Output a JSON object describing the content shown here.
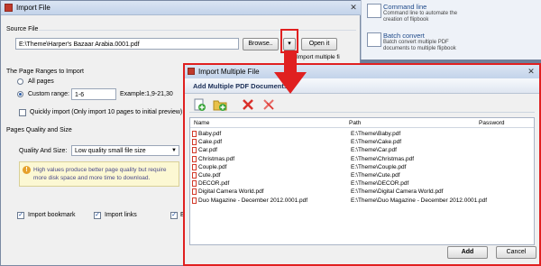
{
  "import_file": {
    "title": "Import File",
    "source_section": "Source File",
    "source_path": "E:\\Theme\\Harper's Bazaar Arabia.0001.pdf",
    "browse_label": "Browse..",
    "open_label": "Open it",
    "import_multiple_label": "Import multiple fi",
    "page_ranges_section": "The Page Ranges to Import",
    "all_pages_label": "All pages",
    "custom_range_label": "Custom range:",
    "custom_range_value": "1-6",
    "range_example": "Example:1,9-21,30",
    "quick_import_label": "Quickly import (Only import 10 pages to  initial  preview)",
    "quality_section": "Pages Quality and Size",
    "quality_label": "Quality And Size:",
    "quality_value": "Low quality small file size",
    "hint_text": "High values produce better page quality but require more disk space and more time to download.",
    "import_bookmark_label": "Import bookmark",
    "import_links_label": "Import links",
    "truncated_label": "Ena"
  },
  "side_panel": {
    "items": [
      {
        "title": "Command line",
        "desc": "Command line to automate the creation of flipbook"
      },
      {
        "title": "Batch convert",
        "desc": "Batch convert multiple PDF documents to multiple flipbook"
      }
    ]
  },
  "multi_window": {
    "title": "Import Multiple File",
    "header": "Add Multiple PDF Documents",
    "toolbar": [
      "add-file-icon",
      "add-folder-icon",
      "remove-icon",
      "remove-all-icon"
    ],
    "columns": [
      "Name",
      "Path",
      "Password"
    ],
    "rows": [
      {
        "name": "Baby.pdf",
        "path": "E:\\Theme\\Baby.pdf"
      },
      {
        "name": "Cake.pdf",
        "path": "E:\\Theme\\Cake.pdf"
      },
      {
        "name": "Car.pdf",
        "path": "E:\\Theme\\Car.pdf"
      },
      {
        "name": "Christmas.pdf",
        "path": "E:\\Theme\\Christmas.pdf"
      },
      {
        "name": "Couple.pdf",
        "path": "E:\\Theme\\Couple.pdf"
      },
      {
        "name": "Cute.pdf",
        "path": "E:\\Theme\\Cute.pdf"
      },
      {
        "name": "DECOR.pdf",
        "path": "E:\\Theme\\DECOR.pdf"
      },
      {
        "name": "Digital Camera World.pdf",
        "path": "E:\\Theme\\Digital Camera World.pdf"
      },
      {
        "name": "Duo Magazine - December 2012.0001.pdf",
        "path": "E:\\Theme\\Duo Magazine - December 2012.0001.pdf"
      }
    ],
    "add_label": "Add",
    "cancel_label": "Cancel"
  },
  "colors": {
    "highlight": "#e02020",
    "title_blue": "#1b2f57"
  }
}
